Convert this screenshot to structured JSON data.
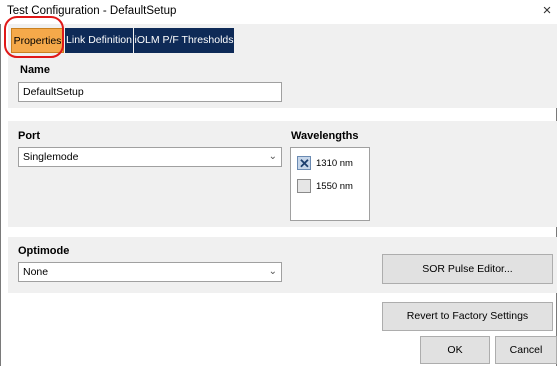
{
  "window": {
    "title": "Test Configuration - DefaultSetup",
    "close_symbol": "×"
  },
  "tabs": [
    {
      "label": "Properties",
      "active": true
    },
    {
      "label": "Link Definition",
      "active": false
    },
    {
      "label": "iOLM P/F Thresholds",
      "active": false
    }
  ],
  "name_section": {
    "label": "Name",
    "value": "DefaultSetup"
  },
  "port_section": {
    "label": "Port",
    "value": "Singlemode"
  },
  "wavelengths_section": {
    "label": "Wavelengths",
    "items": [
      {
        "label": "1310 nm",
        "checked": true
      },
      {
        "label": "1550 nm",
        "checked": false
      }
    ]
  },
  "optimode_section": {
    "label": "Optimode",
    "value": "None"
  },
  "buttons": {
    "sor_pulse_editor": "SOR Pulse Editor...",
    "revert": "Revert to Factory Settings",
    "ok": "OK",
    "cancel": "Cancel"
  },
  "icons": {
    "dropdown": "chevron-down-icon",
    "checkmark": "x-check-icon"
  },
  "colors": {
    "active_tab": "#f5a94a",
    "inactive_tab": "#0e2a57",
    "annotation": "#e01818"
  }
}
